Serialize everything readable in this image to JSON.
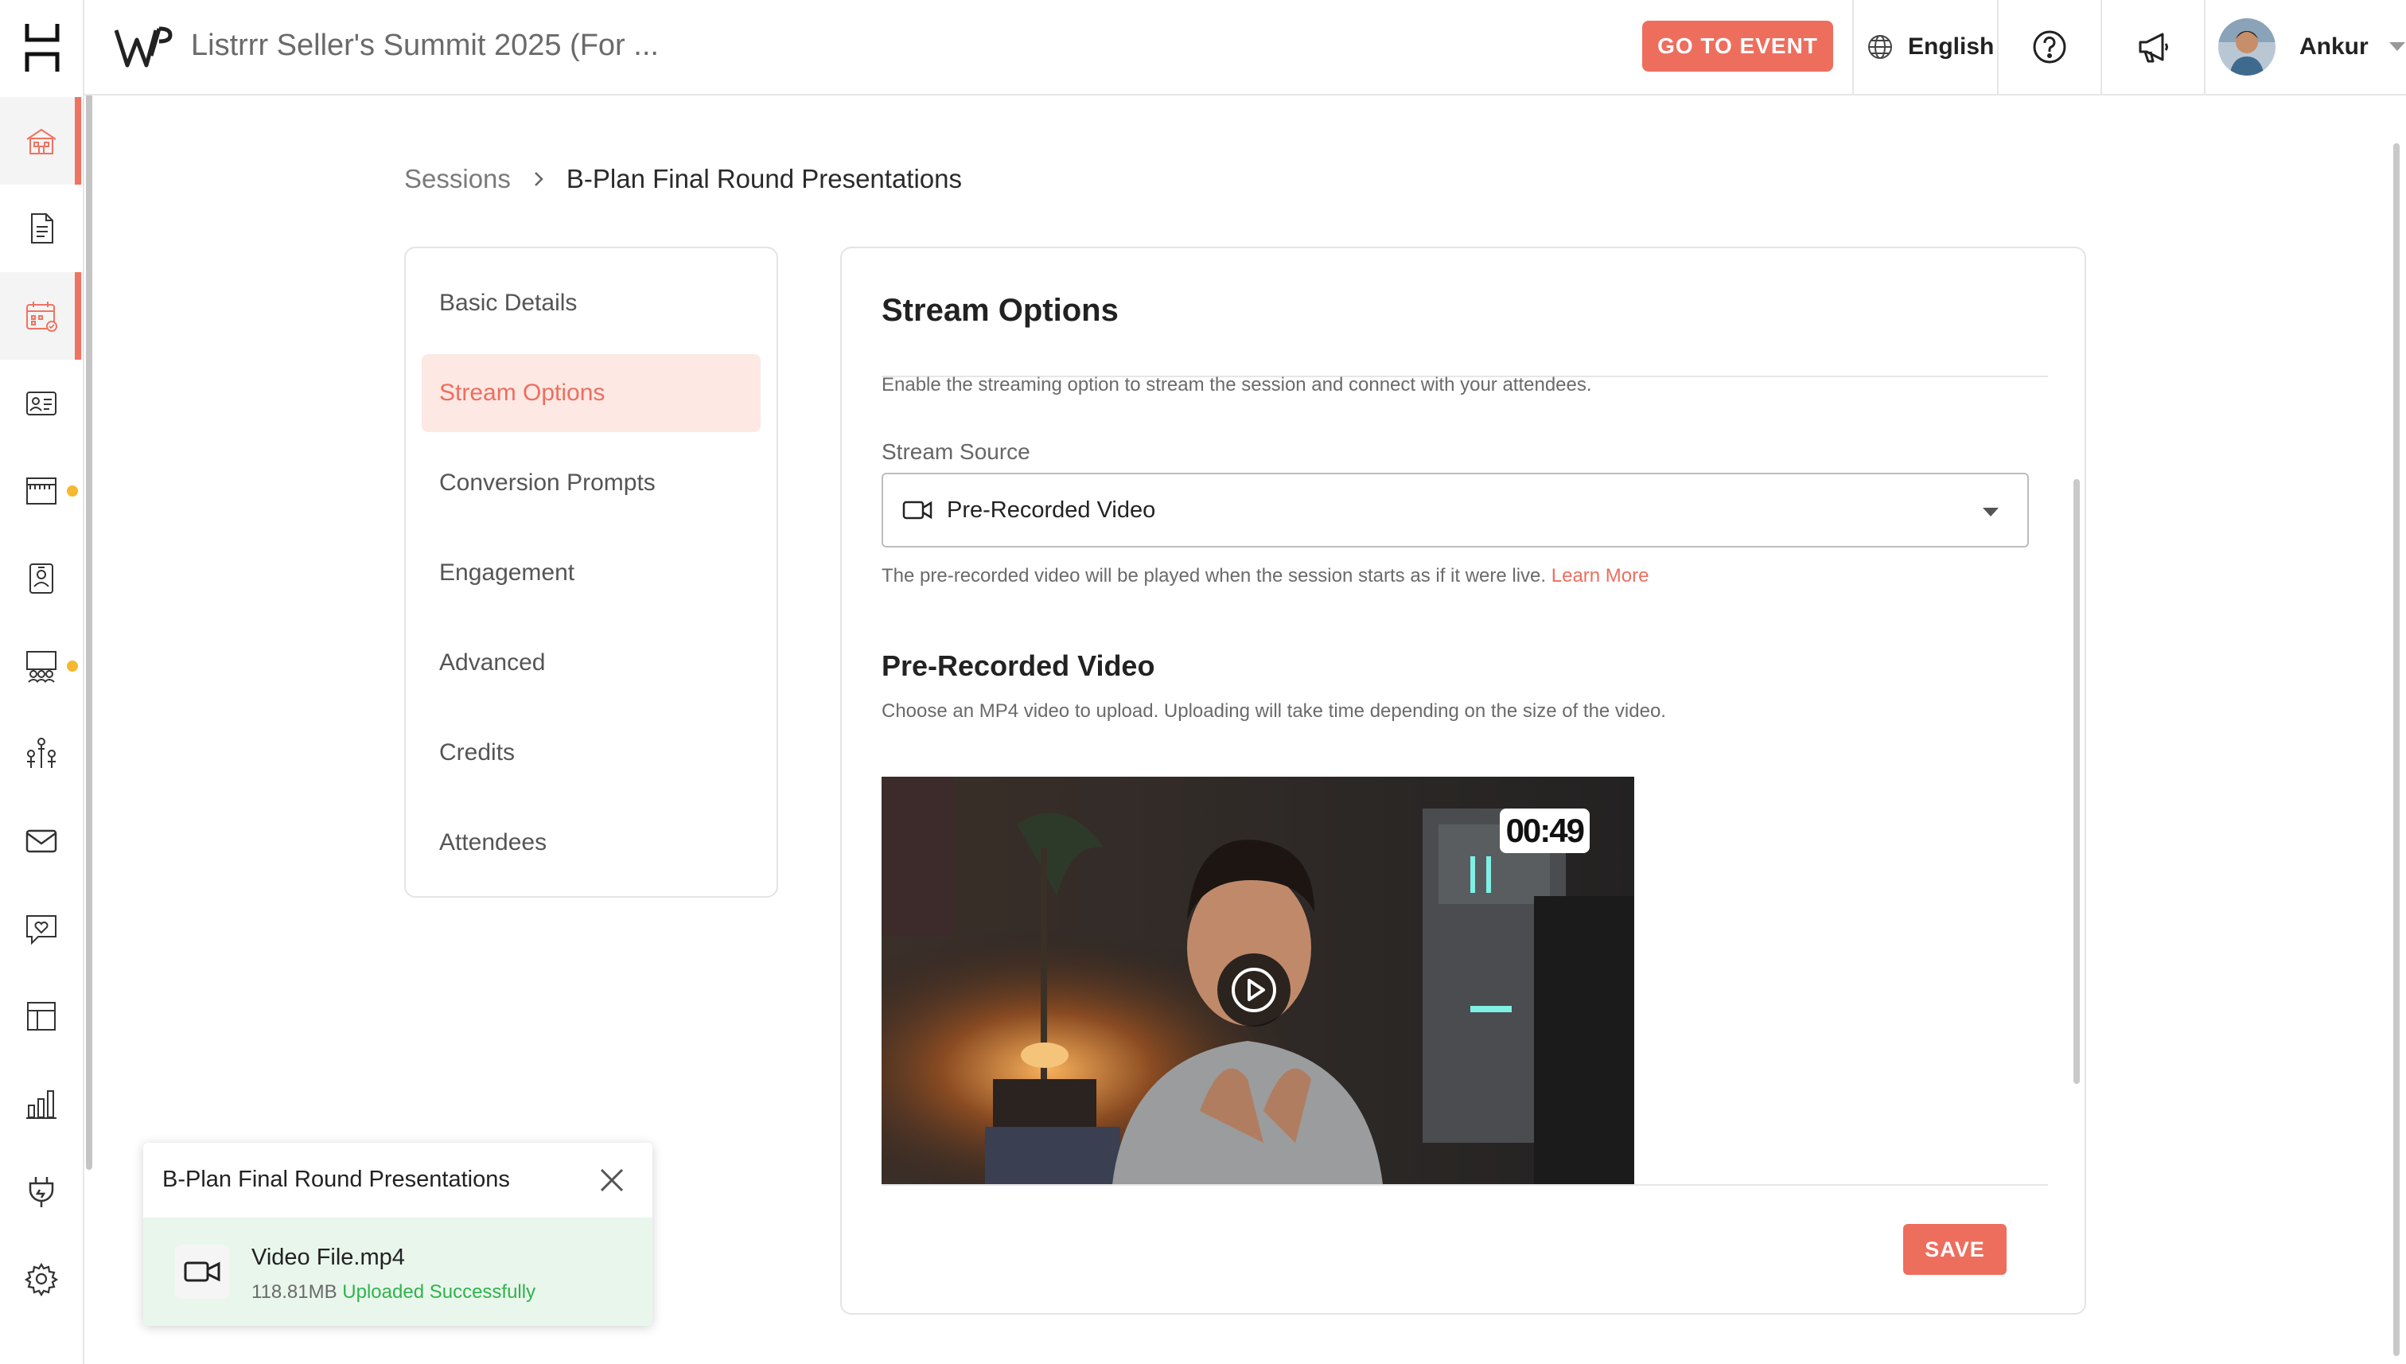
{
  "header": {
    "event_title": "Listrrr Seller's Summit 2025 (For ...",
    "go_to_event_label": "GO TO EVENT",
    "language": "English",
    "user_name": "Ankur"
  },
  "breadcrumb": {
    "root": "Sessions",
    "current": "B-Plan Final Round Presentations"
  },
  "tabs": [
    {
      "label": "Basic Details"
    },
    {
      "label": "Stream Options"
    },
    {
      "label": "Conversion Prompts"
    },
    {
      "label": "Engagement"
    },
    {
      "label": "Advanced"
    },
    {
      "label": "Credits"
    },
    {
      "label": "Attendees"
    }
  ],
  "active_tab": "Stream Options",
  "panel": {
    "title": "Stream Options",
    "description": "Enable the streaming option to stream the session and connect with your attendees.",
    "stream_source_label": "Stream Source",
    "stream_source_value": "Pre-Recorded Video",
    "helper_text": "The pre-recorded video will be played when the session starts as if it were live.",
    "learn_more": "Learn More",
    "video_section_title": "Pre-Recorded Video",
    "video_section_desc": "Choose an MP4 video to upload. Uploading will take time depending on the size of the video.",
    "video_duration": "00:49",
    "save_label": "SAVE"
  },
  "toast": {
    "title": "B-Plan Final Round Presentations",
    "file_name": "Video File.mp4",
    "file_size": "118.81MB",
    "status": "Uploaded Successfully"
  },
  "sidebar": {
    "items": [
      {
        "icon": "home-icon"
      },
      {
        "icon": "document-icon"
      },
      {
        "icon": "calendar-icon"
      },
      {
        "icon": "id-card-icon"
      },
      {
        "icon": "booth-icon"
      },
      {
        "icon": "badge-icon"
      },
      {
        "icon": "stage-icon"
      },
      {
        "icon": "networking-icon"
      },
      {
        "icon": "mail-icon"
      },
      {
        "icon": "engagement-icon"
      },
      {
        "icon": "layout-icon"
      },
      {
        "icon": "analytics-icon"
      },
      {
        "icon": "integrations-icon"
      },
      {
        "icon": "settings-icon"
      }
    ]
  },
  "colors": {
    "accent": "#ee6e5e",
    "accent_light": "#fde8e4",
    "success": "#2fb34b",
    "notification_dot": "#f5b82e"
  }
}
